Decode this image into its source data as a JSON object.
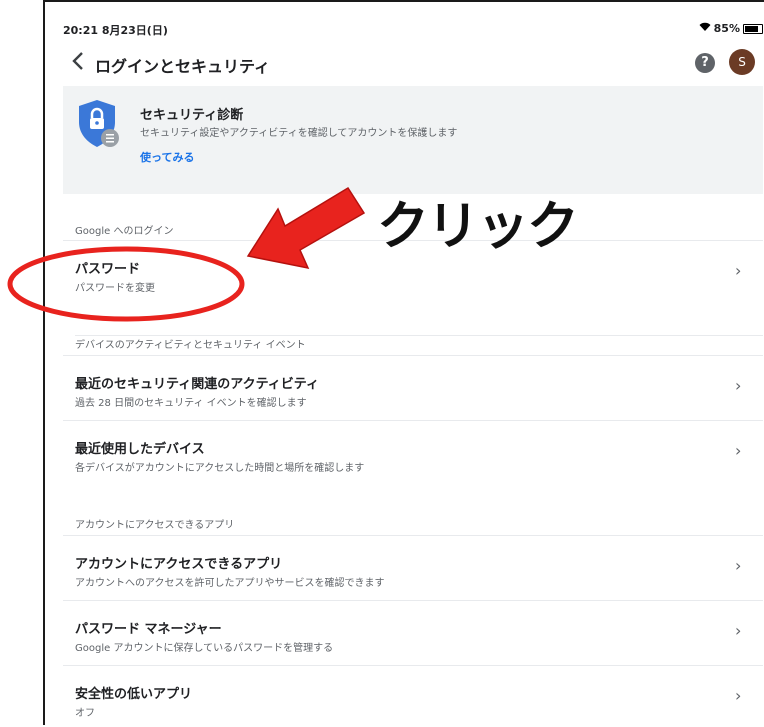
{
  "status_bar": {
    "time": "20:21 8月23日(日)",
    "battery": "85%"
  },
  "app_bar": {
    "title": "ログインとセキュリティ",
    "help_icon": "help-icon",
    "avatar_letter": "S"
  },
  "security_checkup": {
    "title": "セキュリティ診断",
    "description": "セキュリティ設定やアクティビティを確認してアカウントを保護します",
    "link": "使ってみる"
  },
  "sections": {
    "google_login": "Google へのログイン",
    "device_activity": "デバイスのアクティビティとセキュリティ イベント",
    "apps_access": "アカウントにアクセスできるアプリ"
  },
  "items": {
    "password": {
      "title": "パスワード",
      "subtitle": "パスワードを変更"
    },
    "recent_security": {
      "title": "最近のセキュリティ関連のアクティビティ",
      "subtitle": "過去 28 日間のセキュリティ イベントを確認します"
    },
    "recent_devices": {
      "title": "最近使用したデバイス",
      "subtitle": "各デバイスがアカウントにアクセスした時間と場所を確認します"
    },
    "apps_with_access": {
      "title": "アカウントにアクセスできるアプリ",
      "subtitle": "アカウントへのアクセスを許可したアプリやサービスを確認できます"
    },
    "password_manager": {
      "title": "パスワード マネージャー",
      "subtitle": "Google アカウントに保存しているパスワードを管理する"
    },
    "less_secure_apps": {
      "title": "安全性の低いアプリ",
      "subtitle": "オフ"
    }
  },
  "annotation": {
    "label": "クリック",
    "color": "#e8231e"
  },
  "colors": {
    "accent": "#1a73e8",
    "shield": "#3b78d8",
    "avatar": "#6b3b25"
  }
}
